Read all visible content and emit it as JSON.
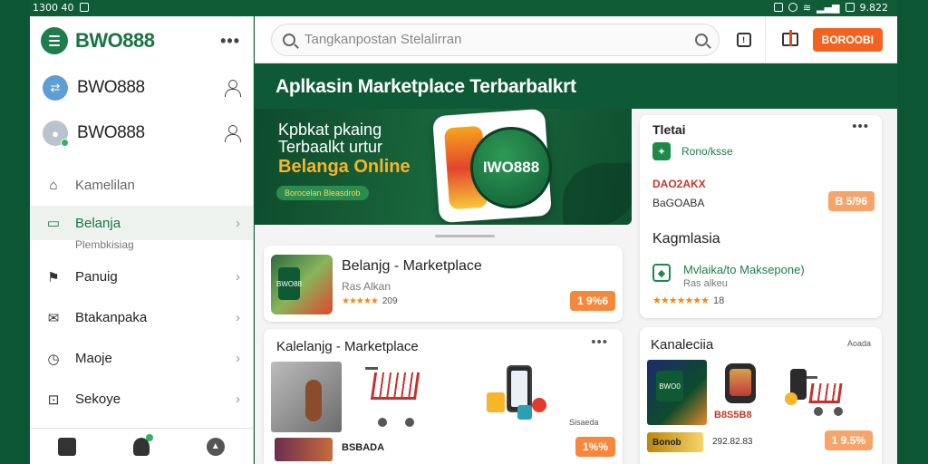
{
  "status": {
    "left": "1300 40",
    "right": "9.822"
  },
  "drawer": {
    "brand": "BWO888",
    "more_label": "•••",
    "accounts": [
      {
        "name": "BWO888"
      },
      {
        "name": "BWO888"
      }
    ],
    "items": [
      {
        "label": "Kamelilan",
        "sub": ""
      },
      {
        "label": "Belanja",
        "sub": "Plembkisiag"
      },
      {
        "label": "Panuig",
        "sub": ""
      },
      {
        "label": "Btakanpaka",
        "sub": ""
      },
      {
        "label": "Maoje",
        "sub": ""
      },
      {
        "label": "Sekoye",
        "sub": ""
      }
    ]
  },
  "header": {
    "search_placeholder": "Tangkanpostan Stelalirran",
    "promo_label": "BOROOBI"
  },
  "page": {
    "title": "Aplkasin Marketplace Terbarbalkrt"
  },
  "banner": {
    "line1": "Kpbkat pkaing",
    "line2": "Terbaalkt urtur",
    "headline": "Belanga Online",
    "pill": "Borocelan Bleasdrob",
    "badge": "IWO888"
  },
  "card_marketplace": {
    "thumb_label": "BWO88",
    "title": "Belanjg - Marketplace",
    "subtitle": "Ras Alkan",
    "stars": "★★★★★",
    "rating": "209",
    "price": "1 9%6"
  },
  "card_products": {
    "title": "Kalelanjg - Marketplace",
    "more_label": "•••",
    "product_label": "Sisaeda",
    "bottom_text": "BSBADA",
    "price": "1%%"
  },
  "card_right_top": {
    "title": "Tletai",
    "more_label": "•••",
    "row1": "Rono/ksse",
    "code": "DAO2AKX",
    "code2": "BaGOABA",
    "price": "B 5/96",
    "section": "Kagmlasia",
    "row2": "Mvlaika/to Maksepone)",
    "row2_sub": "Ras alkeu",
    "stars": "★★★★★★★",
    "rating": "18"
  },
  "card_right_bottom": {
    "title": "Kanaleciia",
    "label": "Aoada",
    "thumb_label": "BWO0",
    "code": "B8S5B8",
    "bar": "Bonob",
    "date": "292.82.83",
    "price": "1 9.5%"
  },
  "colors": {
    "brand_green": "#1a7445",
    "background_green": "#0e5a36",
    "accent_orange": "#f26322",
    "banner_yellow": "#f6b52a"
  }
}
